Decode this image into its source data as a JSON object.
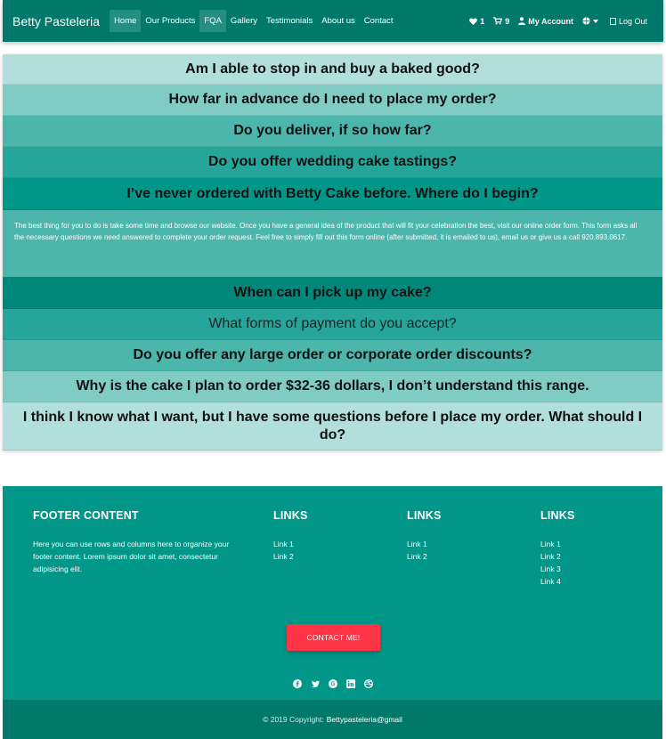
{
  "nav": {
    "brand": "Betty Pasteleria",
    "links": [
      "Home",
      "Our Products",
      "FQA",
      "Gallery",
      "Testimonials",
      "About us",
      "Contact"
    ],
    "wishlist_count": "1",
    "cart_count": "9",
    "account_label": "My Account",
    "logout_label": "Log Out"
  },
  "faq": {
    "questions": [
      "Am I able to stop in and buy a baked good?",
      "How far in advance do I need to place my order?",
      "Do you deliver, if so how far?",
      "Do you offer wedding cake tastings?",
      "I’ve never ordered with Betty Cake before. Where do I begin?",
      "When can I pick up my cake?",
      "What forms of payment do you accept?",
      "Do you offer any large order or corporate order discounts?",
      "Why is the cake I plan to order $32-36 dollars, I don’t understand this range.",
      "I think I know what I want, but I have some questions before I place my order. What should I do?"
    ],
    "answer_text": "The best thing for you to do is take some time and browse our website. Once you have a general idea of the product that will fit your celebration the best, visit our online order form. This form asks all the necessary questions we need answered to complete your order request. Feel free to simply fill out this form online (after submitted, it is emailed to us), email us or give us a call 920.893.0617.",
    "colors": [
      "#b2dfdb",
      "#80cbc4",
      "#4db6ac",
      "#26a69a",
      "#009688",
      "#00897b"
    ]
  },
  "footer": {
    "content_title": "FOOTER CONTENT",
    "content_text": "Here you can use rows and columns here to organize your footer content. Lorem ipsum dolor sit amet, consectetur adipisicing elit.",
    "col2": {
      "title": "LINKS",
      "links": [
        "Link 1",
        "Link 2"
      ]
    },
    "col3": {
      "title": "LINKS",
      "links": [
        "Link 1",
        "Link 2"
      ]
    },
    "col4": {
      "title": "LINKS",
      "links": [
        "Link 1",
        "Link 2",
        "Link 3",
        "Link 4"
      ]
    },
    "contact_button": "CONTACT ME!",
    "socials": [
      "facebook-icon",
      "twitter-icon",
      "google-plus-icon",
      "linkedin-icon",
      "dribbble-icon"
    ],
    "copyright": "© 2019 Copyright:",
    "copyright_owner": "Bettypasteleria@gmail"
  }
}
